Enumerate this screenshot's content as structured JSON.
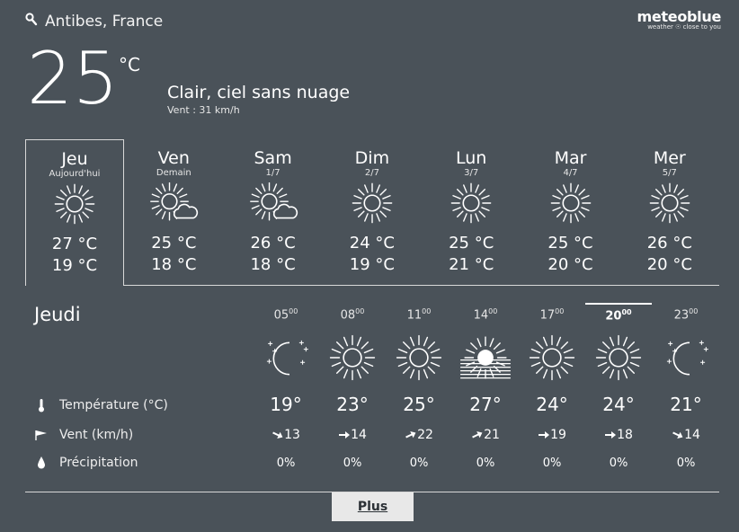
{
  "header": {
    "location": "Antibes, France",
    "brand_name": "meteoblue",
    "brand_tagline": "weather ☉ close to you"
  },
  "current": {
    "temperature": "25",
    "unit": "°C",
    "condition": "Clair, ciel sans nuage",
    "wind": "Vent : 31 km/h"
  },
  "days": [
    {
      "name": "Jeu",
      "sub": "Aujourd'hui",
      "icon": "sun",
      "max": "27 °C",
      "min": "19 °C"
    },
    {
      "name": "Ven",
      "sub": "Demain",
      "icon": "sun-cloud",
      "max": "25 °C",
      "min": "18 °C"
    },
    {
      "name": "Sam",
      "sub": "1/7",
      "icon": "sun-cloud",
      "max": "26 °C",
      "min": "18 °C"
    },
    {
      "name": "Dim",
      "sub": "2/7",
      "icon": "sun",
      "max": "24 °C",
      "min": "19 °C"
    },
    {
      "name": "Lun",
      "sub": "3/7",
      "icon": "sun",
      "max": "25 °C",
      "min": "21 °C"
    },
    {
      "name": "Mar",
      "sub": "4/7",
      "icon": "sun",
      "max": "25 °C",
      "min": "20 °C"
    },
    {
      "name": "Mer",
      "sub": "5/7",
      "icon": "sun",
      "max": "26 °C",
      "min": "20 °C"
    }
  ],
  "detail": {
    "day_name": "Jeudi",
    "labels": {
      "temperature": "Température (°C)",
      "wind": "Vent (km/h)",
      "precipitation": "Précipitation"
    },
    "hours": [
      {
        "hour": "05",
        "min": "00",
        "icon": "moon-stars",
        "temp": "19°",
        "wind_dir": "SE",
        "wind": "13",
        "precip": "0%"
      },
      {
        "hour": "08",
        "min": "00",
        "icon": "sun",
        "temp": "23°",
        "wind_dir": "E",
        "wind": "14",
        "precip": "0%"
      },
      {
        "hour": "11",
        "min": "00",
        "icon": "sun",
        "temp": "25°",
        "wind_dir": "NE",
        "wind": "22",
        "precip": "0%"
      },
      {
        "hour": "14",
        "min": "00",
        "icon": "sun-haze",
        "temp": "27°",
        "wind_dir": "NE",
        "wind": "21",
        "precip": "0%"
      },
      {
        "hour": "17",
        "min": "00",
        "icon": "sun",
        "temp": "24°",
        "wind_dir": "E",
        "wind": "19",
        "precip": "0%"
      },
      {
        "hour": "20",
        "min": "00",
        "icon": "sun",
        "temp": "24°",
        "wind_dir": "E",
        "wind": "18",
        "precip": "0%"
      },
      {
        "hour": "23",
        "min": "00",
        "icon": "moon-stars",
        "temp": "21°",
        "wind_dir": "SE",
        "wind": "14",
        "precip": "0%"
      }
    ],
    "current_index": 5
  },
  "more_button": "Plus"
}
